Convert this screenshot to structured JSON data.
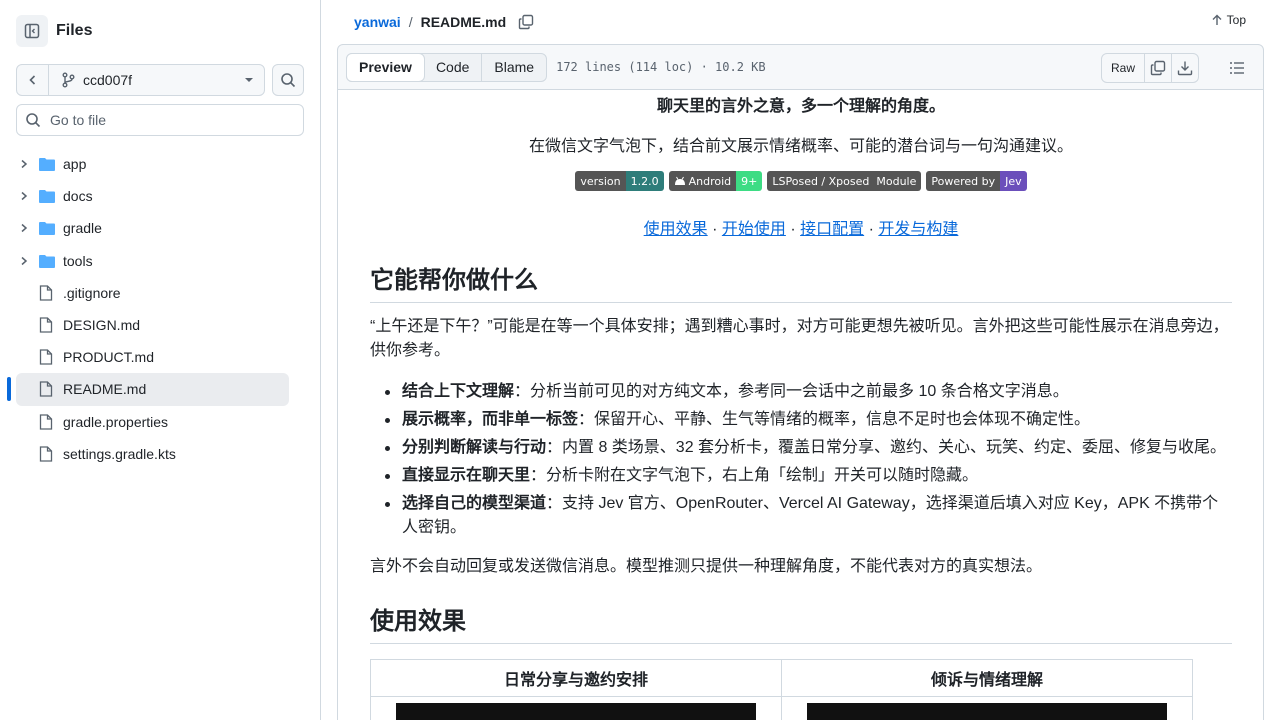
{
  "sidebar": {
    "title": "Files",
    "branch": "ccd007f",
    "goto_placeholder": "Go to file",
    "items": [
      {
        "label": "app",
        "type": "folder"
      },
      {
        "label": "docs",
        "type": "folder"
      },
      {
        "label": "gradle",
        "type": "folder"
      },
      {
        "label": "tools",
        "type": "folder"
      },
      {
        "label": ".gitignore",
        "type": "file"
      },
      {
        "label": "DESIGN.md",
        "type": "file"
      },
      {
        "label": "PRODUCT.md",
        "type": "file"
      },
      {
        "label": "README.md",
        "type": "file",
        "active": true
      },
      {
        "label": "gradle.properties",
        "type": "file"
      },
      {
        "label": "settings.gradle.kts",
        "type": "file"
      }
    ]
  },
  "header": {
    "repo": "yanwai",
    "separator": "/",
    "file": "README.md",
    "top_label": "Top"
  },
  "filebar": {
    "tabs": [
      "Preview",
      "Code",
      "Blame"
    ],
    "active_tab": "Preview",
    "meta": "172 lines (114 loc) · 10.2 KB",
    "raw_label": "Raw"
  },
  "readme": {
    "lead": "聊天里的言外之意，多一个理解的角度。",
    "subtitle": "在微信文字气泡下，结合前文展示情绪概率、可能的潜台词与一句沟通建议。",
    "badges": [
      {
        "left": "version",
        "right": "1.2.0",
        "left_color": "#555555",
        "right_color": "#2e7d7a"
      },
      {
        "left": "Android",
        "right": "9+",
        "left_color": "#555555",
        "right_color": "#3ddc84"
      },
      {
        "left": "LSPosed / Xposed",
        "right": "Module",
        "left_color": "#555555",
        "right_color": "#555555"
      },
      {
        "left": "Powered by",
        "right": "Jev",
        "left_color": "#555555",
        "right_color": "#6b4fbb"
      }
    ],
    "links": [
      "使用效果",
      "开始使用",
      "接口配置",
      "开发与构建"
    ],
    "link_sep": " · ",
    "h2_1": "它能帮你做什么",
    "intro": "“上午还是下午？”可能是在等一个具体安排；遇到糟心事时，对方可能更想先被听见。言外把这些可能性展示在消息旁边，供你参考。",
    "features": [
      {
        "bold": "结合上下文理解",
        "text": "：分析当前可见的对方纯文本，参考同一会话中之前最多 10 条合格文字消息。"
      },
      {
        "bold": "展示概率，而非单一标签",
        "text": "：保留开心、平静、生气等情绪的概率，信息不足时也会体现不确定性。"
      },
      {
        "bold": "分别判断解读与行动",
        "text": "：内置 8 类场景、32 套分析卡，覆盖日常分享、邀约、关心、玩笑、约定、委屈、修复与收尾。"
      },
      {
        "bold": "直接显示在聊天里",
        "text": "：分析卡附在文字气泡下，右上角「绘制」开关可以随时隐藏。"
      },
      {
        "bold": "选择自己的模型渠道",
        "text": "：支持 Jev 官方、OpenRouter、Vercel AI Gateway，选择渠道后填入对应 Key，APK 不携带个人密钥。"
      }
    ],
    "disclaimer": "言外不会自动回复或发送微信消息。模型推测只提供一种理解角度，不能代表对方的真实想法。",
    "h2_2": "使用效果",
    "table_headers": [
      "日常分享与邀约安排",
      "倾诉与情绪理解"
    ]
  }
}
